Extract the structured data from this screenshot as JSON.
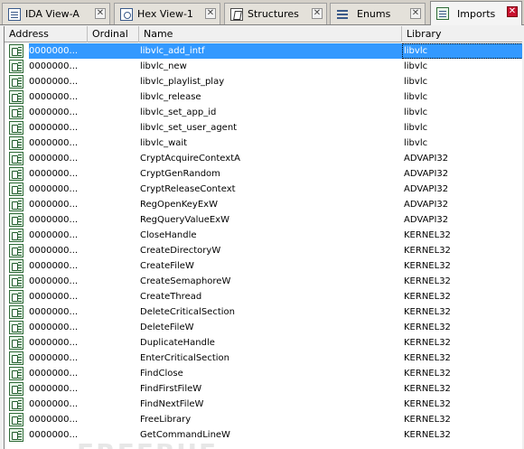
{
  "tabs": [
    {
      "label": "IDA View-A",
      "icon": "ida-view-icon",
      "active": false
    },
    {
      "label": "Hex View-1",
      "icon": "hex-view-icon",
      "active": false
    },
    {
      "label": "Structures",
      "icon": "structures-icon",
      "active": false
    },
    {
      "label": "Enums",
      "icon": "enums-icon",
      "active": false
    },
    {
      "label": "Imports",
      "icon": "imports-icon",
      "active": true
    }
  ],
  "columns": {
    "address": "Address",
    "ordinal": "Ordinal",
    "name": "Name",
    "library": "Library"
  },
  "rows": [
    {
      "address": "0000000...",
      "ordinal": "",
      "name": "libvlc_add_intf",
      "library": "libvlc"
    },
    {
      "address": "0000000...",
      "ordinal": "",
      "name": "libvlc_new",
      "library": "libvlc"
    },
    {
      "address": "0000000...",
      "ordinal": "",
      "name": "libvlc_playlist_play",
      "library": "libvlc"
    },
    {
      "address": "0000000...",
      "ordinal": "",
      "name": "libvlc_release",
      "library": "libvlc"
    },
    {
      "address": "0000000...",
      "ordinal": "",
      "name": "libvlc_set_app_id",
      "library": "libvlc"
    },
    {
      "address": "0000000...",
      "ordinal": "",
      "name": "libvlc_set_user_agent",
      "library": "libvlc"
    },
    {
      "address": "0000000...",
      "ordinal": "",
      "name": "libvlc_wait",
      "library": "libvlc"
    },
    {
      "address": "0000000...",
      "ordinal": "",
      "name": "CryptAcquireContextA",
      "library": "ADVAPI32"
    },
    {
      "address": "0000000...",
      "ordinal": "",
      "name": "CryptGenRandom",
      "library": "ADVAPI32"
    },
    {
      "address": "0000000...",
      "ordinal": "",
      "name": "CryptReleaseContext",
      "library": "ADVAPI32"
    },
    {
      "address": "0000000...",
      "ordinal": "",
      "name": "RegOpenKeyExW",
      "library": "ADVAPI32"
    },
    {
      "address": "0000000...",
      "ordinal": "",
      "name": "RegQueryValueExW",
      "library": "ADVAPI32"
    },
    {
      "address": "0000000...",
      "ordinal": "",
      "name": "CloseHandle",
      "library": "KERNEL32"
    },
    {
      "address": "0000000...",
      "ordinal": "",
      "name": "CreateDirectoryW",
      "library": "KERNEL32"
    },
    {
      "address": "0000000...",
      "ordinal": "",
      "name": "CreateFileW",
      "library": "KERNEL32"
    },
    {
      "address": "0000000...",
      "ordinal": "",
      "name": "CreateSemaphoreW",
      "library": "KERNEL32"
    },
    {
      "address": "0000000...",
      "ordinal": "",
      "name": "CreateThread",
      "library": "KERNEL32"
    },
    {
      "address": "0000000...",
      "ordinal": "",
      "name": "DeleteCriticalSection",
      "library": "KERNEL32"
    },
    {
      "address": "0000000...",
      "ordinal": "",
      "name": "DeleteFileW",
      "library": "KERNEL32"
    },
    {
      "address": "0000000...",
      "ordinal": "",
      "name": "DuplicateHandle",
      "library": "KERNEL32"
    },
    {
      "address": "0000000...",
      "ordinal": "",
      "name": "EnterCriticalSection",
      "library": "KERNEL32"
    },
    {
      "address": "0000000...",
      "ordinal": "",
      "name": "FindClose",
      "library": "KERNEL32"
    },
    {
      "address": "0000000...",
      "ordinal": "",
      "name": "FindFirstFileW",
      "library": "KERNEL32"
    },
    {
      "address": "0000000...",
      "ordinal": "",
      "name": "FindNextFileW",
      "library": "KERNEL32"
    },
    {
      "address": "0000000...",
      "ordinal": "",
      "name": "FreeLibrary",
      "library": "KERNEL32"
    },
    {
      "address": "0000000...",
      "ordinal": "",
      "name": "GetCommandLineW",
      "library": "KERNEL32"
    }
  ],
  "selected_row": 0,
  "watermark": "FREEBUF",
  "colors": {
    "selection": "#3399ff",
    "active_close": "#c8102e"
  }
}
